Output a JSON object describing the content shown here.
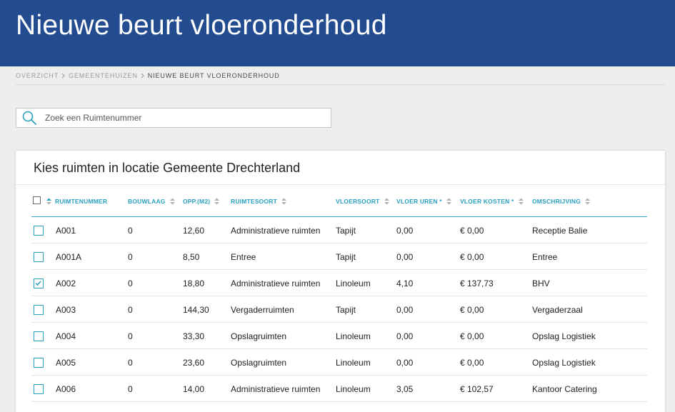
{
  "header": {
    "title": "Nieuwe beurt vloeronderhoud"
  },
  "breadcrumb": [
    {
      "label": "OVERZICHT"
    },
    {
      "label": "GEMEENTEHUIZEN"
    },
    {
      "label": "NIEUWE BEURT VLOERONDERHOUD"
    }
  ],
  "search": {
    "placeholder": "Zoek een Ruimtenummer",
    "value": ""
  },
  "card": {
    "title": "Kies ruimten in locatie Gemeente Drechterland",
    "columns": [
      "RUIMTENUMMER",
      "BOUWLAAG",
      "OPP.(M2)",
      "RUIMTESOORT",
      "VLOERSOORT",
      "VLOER UREN *",
      "VLOER KOSTEN *",
      "OMSCHRIJVING"
    ],
    "rows": [
      {
        "checked": false,
        "cells": [
          "A001",
          "0",
          "12,60",
          "Administratieve ruimten",
          "Tapijt",
          "0,00",
          "€ 0,00",
          "Receptie Balie"
        ]
      },
      {
        "checked": false,
        "cells": [
          "A001A",
          "0",
          "8,50",
          "Entree",
          "Tapijt",
          "0,00",
          "€ 0,00",
          "Entree"
        ]
      },
      {
        "checked": true,
        "cells": [
          "A002",
          "0",
          "18,80",
          "Administratieve ruimten",
          "Linoleum",
          "4,10",
          "€ 137,73",
          "BHV"
        ]
      },
      {
        "checked": false,
        "cells": [
          "A003",
          "0",
          "144,30",
          "Vergaderruimten",
          "Tapijt",
          "0,00",
          "€ 0,00",
          "Vergaderzaal"
        ]
      },
      {
        "checked": false,
        "cells": [
          "A004",
          "0",
          "33,30",
          "Opslagruimten",
          "Linoleum",
          "0,00",
          "€ 0,00",
          "Opslag Logistiek"
        ]
      },
      {
        "checked": false,
        "cells": [
          "A005",
          "0",
          "23,60",
          "Opslagruimten",
          "Linoleum",
          "0,00",
          "€ 0,00",
          "Opslag Logistiek"
        ]
      },
      {
        "checked": false,
        "cells": [
          "A006",
          "0",
          "14,00",
          "Administratieve ruimten",
          "Linoleum",
          "3,05",
          "€ 102,57",
          "Kantoor Catering"
        ]
      }
    ]
  },
  "colors": {
    "header_bg": "#234b8f",
    "accent": "#2aa0c0"
  }
}
